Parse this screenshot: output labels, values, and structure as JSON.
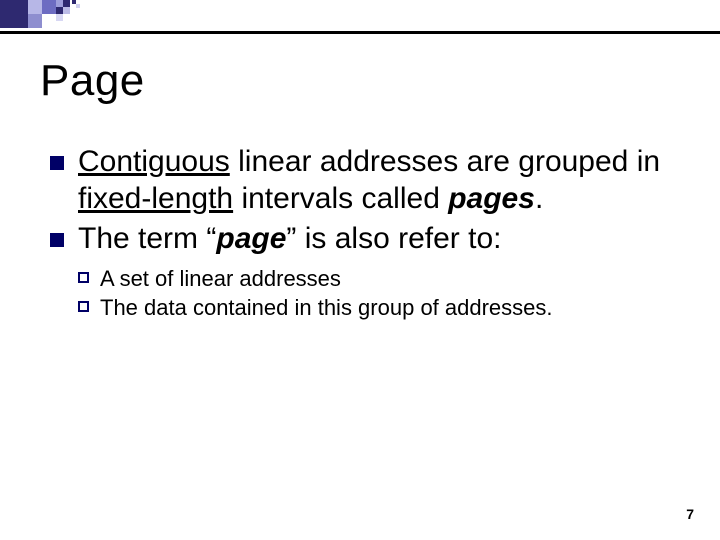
{
  "title": "Page",
  "bullets": {
    "b1": {
      "t1": "Contiguous",
      "t2": " linear addresses are grouped in ",
      "t3": "fixed-length",
      "t4": " intervals called ",
      "t5": "pages",
      "t6": "."
    },
    "b2": {
      "t1": "The term ",
      "t2": "“",
      "t3": "page",
      "t4": "”",
      "t5": " is also refer to:"
    },
    "sub1": "A set of linear addresses",
    "sub2": "The data contained in this group of addresses."
  },
  "page_number": "7"
}
